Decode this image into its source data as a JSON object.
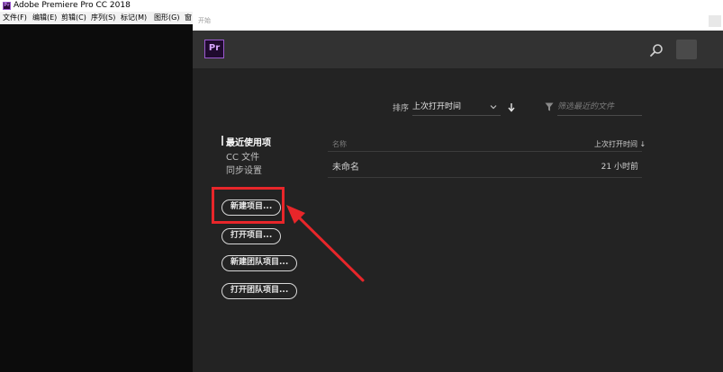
{
  "app": {
    "title": "Adobe Premiere Pro CC 2018",
    "icon_text": "Pr",
    "menus": [
      "文件(F)",
      "编辑(E)",
      "剪辑(C)",
      "序列(S)",
      "标记(M)",
      "图形(G)",
      "窗"
    ]
  },
  "dialog": {
    "title": "开始",
    "logo": "Pr",
    "sort": {
      "label": "排序",
      "selected": "上次打开时间"
    },
    "filter": {
      "placeholder": "筛选最近的文件"
    },
    "nav": {
      "items": [
        "最近使用项",
        "CC 文件",
        "同步设置"
      ]
    },
    "buttons": {
      "new_project": "新建项目...",
      "open_project": "打开项目...",
      "new_team_project": "新建团队项目...",
      "open_team_project": "打开团队项目..."
    },
    "recent": {
      "col_name": "名称",
      "col_date": "上次打开时间 ↓",
      "rows": [
        {
          "name": "未命名",
          "time": "21 小时前"
        }
      ]
    }
  },
  "colors": {
    "accent_purple": "#9b59d0",
    "annotation_red": "#e8262a",
    "dialog_bg": "#232323",
    "header_bg": "#323232"
  }
}
